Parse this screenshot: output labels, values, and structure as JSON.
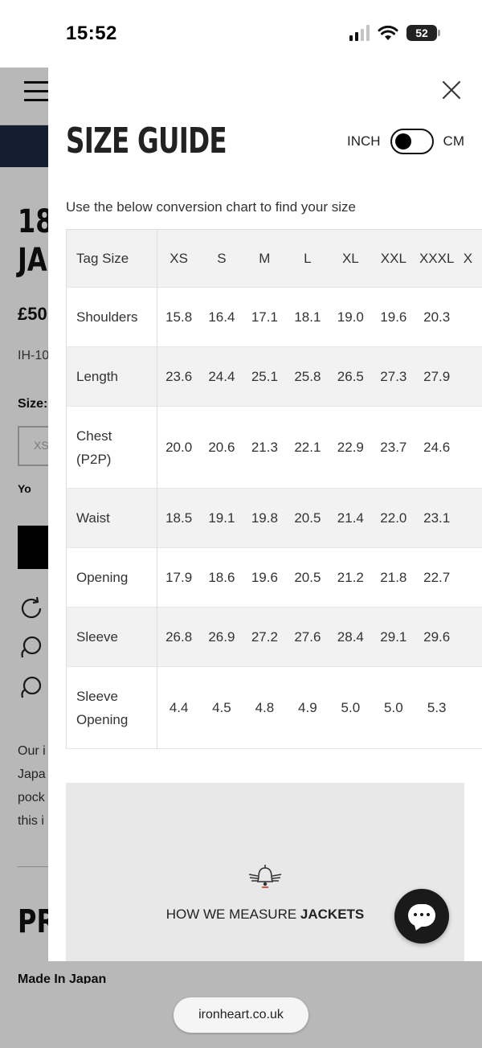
{
  "status_bar": {
    "time": "15:52",
    "battery": "52"
  },
  "background_page": {
    "title_line1": "18",
    "title_line2": "JAC",
    "price": "£50",
    "sku": "IH-10",
    "size_label": "Size:",
    "size_option": "XS",
    "notify_text": "Yo",
    "description_lines": [
      "Our i",
      "Japa",
      "pock",
      "this i"
    ],
    "section_heading": "PR",
    "made_in": "Made In Japan"
  },
  "modal": {
    "title": "SIZE GUIDE",
    "toggle": {
      "left_label": "INCH",
      "right_label": "CM",
      "selected": "INCH"
    },
    "intro": "Use the below conversion chart to find your size",
    "table": {
      "header_label": "Tag Size",
      "sizes": [
        "XS",
        "S",
        "M",
        "L",
        "XL",
        "XXL",
        "XXXL",
        "X"
      ],
      "rows": [
        {
          "label_lines": [
            "Shoulders"
          ],
          "values": [
            "15.8",
            "16.4",
            "17.1",
            "18.1",
            "19.0",
            "19.6",
            "20.3"
          ]
        },
        {
          "label_lines": [
            "Length"
          ],
          "values": [
            "23.6",
            "24.4",
            "25.1",
            "25.8",
            "26.5",
            "27.3",
            "27.9"
          ]
        },
        {
          "label_lines": [
            "Chest",
            "(P2P)"
          ],
          "values": [
            "20.0",
            "20.6",
            "21.3",
            "22.1",
            "22.9",
            "23.7",
            "24.6"
          ]
        },
        {
          "label_lines": [
            "Waist"
          ],
          "values": [
            "18.5",
            "19.1",
            "19.8",
            "20.5",
            "21.4",
            "22.0",
            "23.1"
          ]
        },
        {
          "label_lines": [
            "Opening"
          ],
          "values": [
            "17.9",
            "18.6",
            "19.6",
            "20.5",
            "21.2",
            "21.8",
            "22.7"
          ]
        },
        {
          "label_lines": [
            "Sleeve"
          ],
          "values": [
            "26.8",
            "26.9",
            "27.2",
            "27.6",
            "28.4",
            "29.1",
            "29.6"
          ]
        },
        {
          "label_lines": [
            "Sleeve",
            "Opening"
          ],
          "values": [
            "4.4",
            "4.5",
            "4.8",
            "4.9",
            "5.0",
            "5.0",
            "5.3"
          ]
        }
      ]
    },
    "measure_card": {
      "prefix": "HOW WE MEASURE ",
      "emphasis": "JACKETS",
      "icon": "winged-bell-icon"
    }
  },
  "chat_button": {
    "icon": "chat-bubble-icon"
  },
  "browser": {
    "url": "ironheart.co.uk"
  },
  "colors": {
    "accent": "#000000",
    "card_bg": "#e8e8e8",
    "row_alt": "#f2f2f2"
  }
}
